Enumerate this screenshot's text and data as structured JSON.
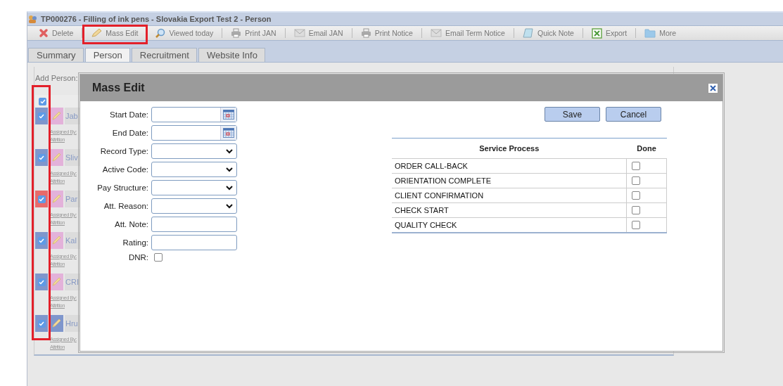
{
  "window": {
    "title": "TP000276 - Filling of ink pens - Slovakia Export Test 2 - Person"
  },
  "toolbar": [
    {
      "label": "Delete",
      "highlighted": false
    },
    {
      "label": "Mass Edit",
      "highlighted": true
    },
    {
      "label": "Viewed today",
      "highlighted": false
    },
    {
      "label": "Print JAN",
      "highlighted": false
    },
    {
      "label": "Email JAN",
      "highlighted": false
    },
    {
      "label": "Print Notice",
      "highlighted": false
    },
    {
      "label": "Email Term Notice",
      "highlighted": false
    },
    {
      "label": "Quick Note",
      "highlighted": false
    },
    {
      "label": "Export",
      "highlighted": false
    },
    {
      "label": "More",
      "highlighted": false
    }
  ],
  "tabs": [
    {
      "label": "Summary",
      "selected": false
    },
    {
      "label": "Person",
      "selected": true
    },
    {
      "label": "Recruitment",
      "selected": false
    },
    {
      "label": "Website Info",
      "selected": false
    }
  ],
  "people": {
    "add_label": "Add Person:",
    "select_all_checked": true,
    "checkbox_column_highlighted": true,
    "rows": [
      {
        "name": "Jab",
        "checked": true,
        "color": "#7f96cc",
        "edit_tag": {
          "color": "#e3b2da"
        },
        "assigned_by": "Assigned By:",
        "attrition_reason": "Attrition"
      },
      {
        "name": "Sliv",
        "checked": true,
        "color": "#7f96cc",
        "edit_tag": {
          "color": "#e3b2da"
        },
        "assigned_by": "Assigned By:",
        "attrition_reason": "Attrition"
      },
      {
        "name": "Par",
        "checked": true,
        "color": "#e86a6a",
        "edit_tag": {
          "color": "#e3b2da"
        },
        "assigned_by": "Assigned By:",
        "attrition_reason": "Attrition"
      },
      {
        "name": "Kal",
        "checked": true,
        "color": "#7f96cc",
        "edit_tag": {
          "color": "#e3b2da"
        },
        "assigned_by": "Assigned By:",
        "attrition_reason": "Attrition"
      },
      {
        "name": "CRI",
        "checked": true,
        "color": "#7f96cc",
        "edit_tag": {
          "color": "#e3b2da"
        },
        "assigned_by": "Assigned By:",
        "attrition_reason": "Attrition"
      },
      {
        "name": "Hru",
        "checked": true,
        "color": "#7f96cc",
        "edit_tag": {
          "color": "#7f96cc"
        },
        "assigned_by": "Assigned By:",
        "attrition_reason": "Attrition"
      }
    ]
  },
  "dialog": {
    "title": "Mass Edit",
    "fields": [
      {
        "label": "Start Date:",
        "kind": "date"
      },
      {
        "label": "End Date:",
        "kind": "date"
      },
      {
        "label": "Record Type:",
        "kind": "select"
      },
      {
        "label": "Active Code:",
        "kind": "select"
      },
      {
        "label": "Pay Structure:",
        "kind": "select"
      },
      {
        "label": "Att. Reason:",
        "kind": "select"
      },
      {
        "label": "Att. Note:",
        "kind": "text"
      },
      {
        "label": "Rating:",
        "kind": "text"
      },
      {
        "label": "DNR:",
        "kind": "checkbox",
        "checked": false
      }
    ],
    "buttons": [
      "Save",
      "Cancel"
    ],
    "table": {
      "columns": [
        "Service Process",
        "Done"
      ],
      "rows": [
        {
          "process": "ORDER CALL-BACK",
          "done": false
        },
        {
          "process": "ORIENTATION COMPLETE",
          "done": false
        },
        {
          "process": "CLIENT CONFIRMATION",
          "done": false
        },
        {
          "process": "CHECK START",
          "done": false
        },
        {
          "process": "QUALITY CHECK",
          "done": false
        }
      ]
    }
  }
}
